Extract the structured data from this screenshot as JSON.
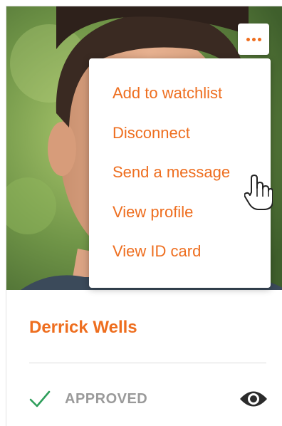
{
  "profile": {
    "name": "Derrick Wells",
    "status": "APPROVED"
  },
  "menu": {
    "items": [
      {
        "label": "Add to watchlist"
      },
      {
        "label": "Disconnect"
      },
      {
        "label": "Send a message"
      },
      {
        "label": "View profile"
      },
      {
        "label": "View ID card"
      }
    ]
  },
  "colors": {
    "accent": "#ee6e1f",
    "status_check": "#2e9e5b",
    "status_text": "#9a9a9a"
  },
  "icons": {
    "more": "more-horizontal-icon",
    "cursor": "hand-pointer-cursor-icon",
    "status": "checkmark-icon",
    "visibility": "eye-icon"
  }
}
